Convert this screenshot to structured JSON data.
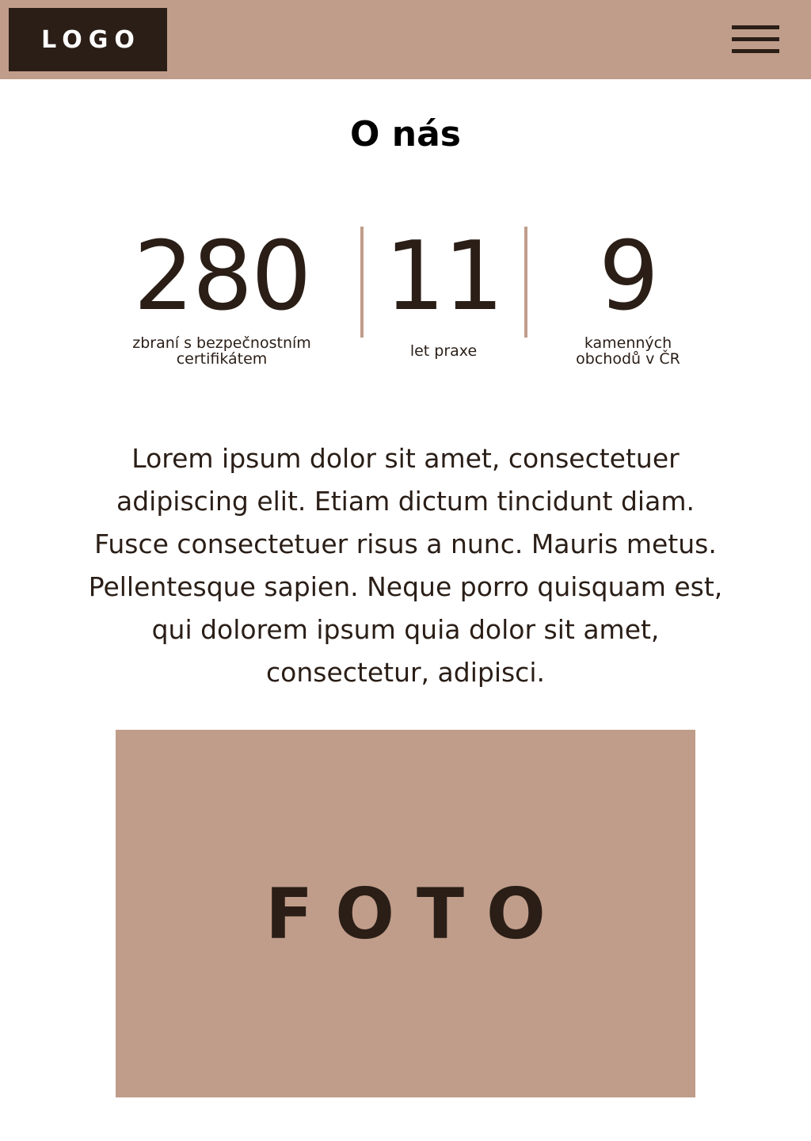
{
  "header": {
    "logo_text": "LOGO",
    "menu_icon": "hamburger-menu-icon"
  },
  "section": {
    "title": "O nás"
  },
  "stats": [
    {
      "number": "280",
      "label": "zbraní s bezpečnostním certifikátem"
    },
    {
      "number": "11",
      "label": "let praxe"
    },
    {
      "number": "9",
      "label": "kamenných obchodů v ČR"
    }
  ],
  "body_text": "Lorem ipsum dolor sit amet, consectetuer adipiscing elit. Etiam dictum tincidunt diam. Fusce consectetuer risus a nunc. Mauris metus. Pellentesque sapien. Neque porro quisquam est, qui dolorem ipsum quia dolor sit amet, consectetur, adipisci.",
  "photo": {
    "label": "FOTO"
  },
  "colors": {
    "accent": "#c09d8a",
    "dark": "#2a1e17",
    "background": "#ffffff"
  }
}
